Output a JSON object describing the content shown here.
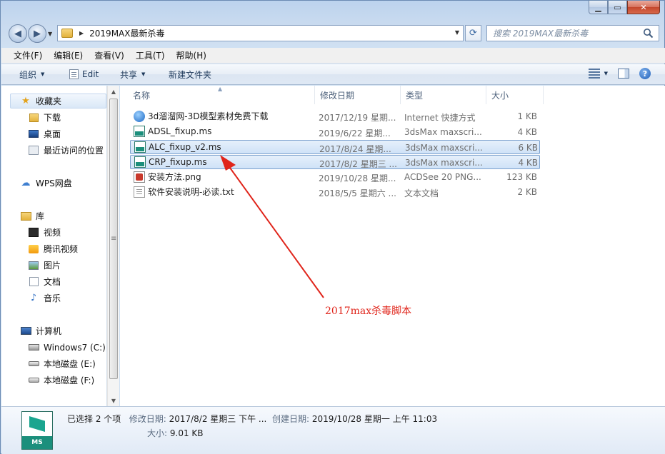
{
  "address": {
    "path": "2019MAX最新杀毒"
  },
  "search": {
    "placeholder": "搜索 2019MAX最新杀毒"
  },
  "menu": [
    "文件(F)",
    "编辑(E)",
    "查看(V)",
    "工具(T)",
    "帮助(H)"
  ],
  "toolbar": {
    "organize": "组织",
    "edit": "Edit",
    "share": "共享",
    "new_folder": "新建文件夹"
  },
  "nav": {
    "favorites": "收藏夹",
    "favorites_items": [
      "下载",
      "桌面",
      "最近访问的位置"
    ],
    "wps": "WPS网盘",
    "libraries": "库",
    "libraries_items": [
      "视频",
      "腾讯视频",
      "图片",
      "文档",
      "音乐"
    ],
    "computer": "计算机",
    "computer_items": [
      "Windows7 (C:)",
      "本地磁盘 (E:)",
      "本地磁盘 (F:)"
    ]
  },
  "columns": {
    "name": "名称",
    "date": "修改日期",
    "type": "类型",
    "size": "大小"
  },
  "files": [
    {
      "name": "3d溜溜网-3D模型素材免费下载",
      "date": "2017/12/19 星期...",
      "type": "Internet 快捷方式",
      "size": "1 KB",
      "icon": "url-icon",
      "selected": false
    },
    {
      "name": "ADSL_fixup.ms",
      "date": "2019/6/22 星期...",
      "type": "3dsMax maxscri...",
      "size": "4 KB",
      "icon": "maxscript-icon",
      "selected": false
    },
    {
      "name": "ALC_fixup_v2.ms",
      "date": "2017/8/24 星期...",
      "type": "3dsMax maxscri...",
      "size": "6 KB",
      "icon": "maxscript-icon",
      "selected": true
    },
    {
      "name": "CRP_fixup.ms",
      "date": "2017/8/2 星期三 ...",
      "type": "3dsMax maxscri...",
      "size": "4 KB",
      "icon": "maxscript-icon",
      "selected": true
    },
    {
      "name": "安装方法.png",
      "date": "2019/10/28 星期...",
      "type": "ACDSee 20 PNG...",
      "size": "123 KB",
      "icon": "png-icon",
      "selected": false
    },
    {
      "name": "软件安装说明-必读.txt",
      "date": "2018/5/5 星期六 ...",
      "type": "文本文档",
      "size": "2 KB",
      "icon": "txt-icon",
      "selected": false
    }
  ],
  "annotation": {
    "text": "2017max杀毒脚本",
    "color": "#e0251b"
  },
  "details": {
    "selected_count": "已选择 2 个项",
    "modified_label": "修改日期:",
    "modified_value": "2017/8/2 星期三 下午 ...",
    "created_label": "创建日期:",
    "created_value": "2019/10/28 星期一 上午 11:03",
    "size_label": "大小:",
    "size_value": "9.01 KB",
    "icon_label": "MS"
  }
}
